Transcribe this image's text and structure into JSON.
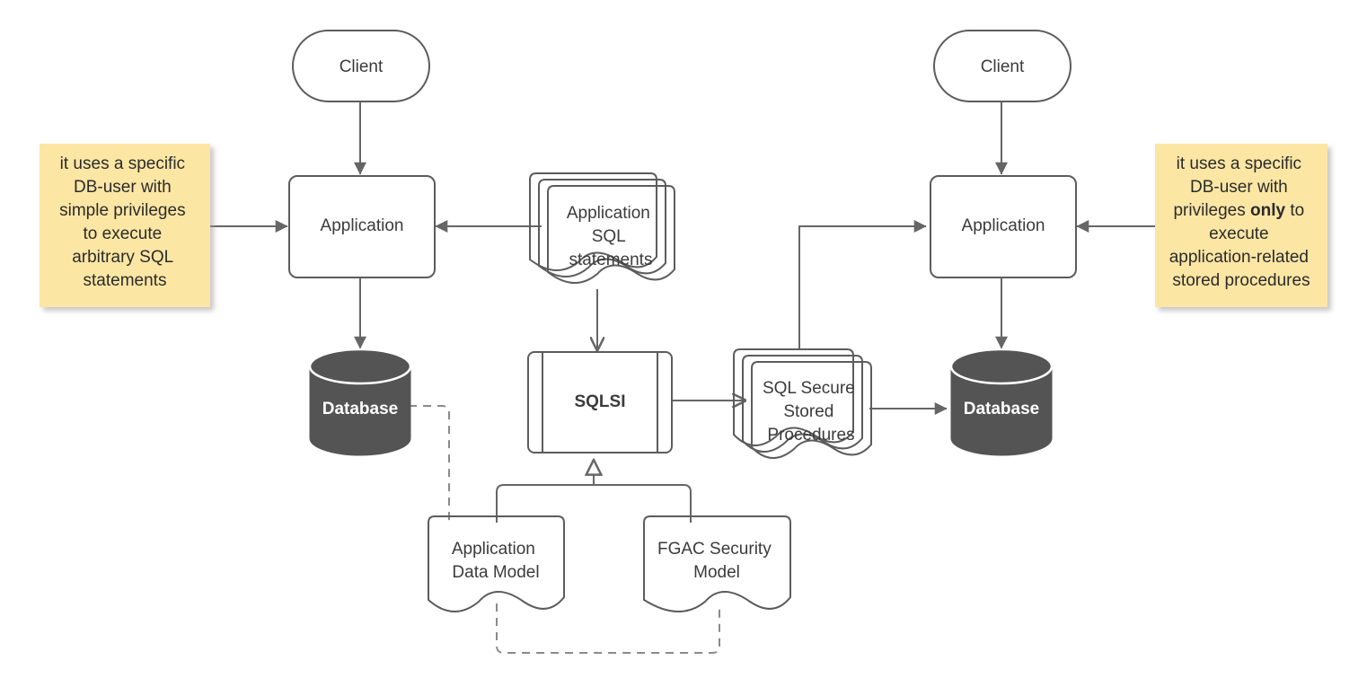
{
  "diagram": {
    "title": "SQLSI secure database access architecture",
    "colors": {
      "background": "#ffffff",
      "stroke": "#5c5c5c",
      "edge": "#666666",
      "edge_dashed": "#8a8a8a",
      "note_fill": "#fce6a4",
      "document_gray_fill": "#d3d3d3",
      "document_yellow_fill": "#fce6a4",
      "sqlsi_fill": "#9fd5f3",
      "database_fill": "#545454",
      "text": "#3b3b3b",
      "database_text": "#ffffff"
    },
    "nodes": {
      "client_left": {
        "label": "Client",
        "shape": "stadium"
      },
      "client_right": {
        "label": "Client",
        "shape": "stadium"
      },
      "application_left": {
        "label": "Application",
        "shape": "rounded-rect"
      },
      "application_right": {
        "label": "Application",
        "shape": "rounded-rect"
      },
      "database_left": {
        "label": "Database",
        "shape": "cylinder"
      },
      "database_right": {
        "label": "Database",
        "shape": "cylinder"
      },
      "application_sql_statements": {
        "lines": [
          "Application",
          "SQL",
          "statements"
        ],
        "shape": "stacked-document"
      },
      "sql_secure_stored_procedures": {
        "lines": [
          "SQL Secure",
          "Stored",
          "Procedures"
        ],
        "shape": "stacked-document"
      },
      "sqlsi": {
        "label": "SQLSI",
        "shape": "component"
      },
      "application_data_model": {
        "lines": [
          "Application",
          "Data Model"
        ],
        "shape": "document"
      },
      "fgac_security_model": {
        "lines": [
          "FGAC Security",
          "Model"
        ],
        "shape": "document"
      }
    },
    "notes": {
      "left": {
        "lines": [
          [
            {
              "text": "it uses a specific",
              "bold": false
            }
          ],
          [
            {
              "text": "DB-user with",
              "bold": false
            }
          ],
          [
            {
              "text": "simple privileges",
              "bold": false
            }
          ],
          [
            {
              "text": "to execute",
              "bold": false
            }
          ],
          [
            {
              "text": "arbitrary SQL",
              "bold": false
            }
          ],
          [
            {
              "text": "statements",
              "bold": false
            }
          ]
        ]
      },
      "right": {
        "lines": [
          [
            {
              "text": "it uses a specific",
              "bold": false
            }
          ],
          [
            {
              "text": "DB-user with",
              "bold": false
            }
          ],
          [
            {
              "text": "privileges ",
              "bold": false
            },
            {
              "text": "only",
              "bold": true
            },
            {
              "text": " to",
              "bold": false
            }
          ],
          [
            {
              "text": "execute",
              "bold": false
            }
          ],
          [
            {
              "text": "application-related",
              "bold": false
            }
          ],
          [
            {
              "text": "stored procedures",
              "bold": false
            }
          ]
        ]
      }
    },
    "edges": [
      {
        "from": "client_left",
        "to": "application_left",
        "style": "solid",
        "arrow": "filled"
      },
      {
        "from": "application_sql_statements",
        "to": "application_left",
        "style": "solid",
        "arrow": "filled"
      },
      {
        "from": "note_left",
        "to": "application_left",
        "style": "solid",
        "arrow": "filled"
      },
      {
        "from": "application_left",
        "to": "database_left",
        "style": "solid",
        "arrow": "filled"
      },
      {
        "from": "application_sql_statements",
        "to": "sqlsi",
        "style": "solid",
        "arrow": "open"
      },
      {
        "from": "sqlsi",
        "to": "sql_secure_stored_procedures",
        "style": "solid",
        "arrow": "open"
      },
      {
        "from": "sql_secure_stored_procedures",
        "to": "application_right",
        "style": "solid",
        "arrow": "filled"
      },
      {
        "from": "sql_secure_stored_procedures",
        "to": "database_right",
        "style": "solid",
        "arrow": "filled"
      },
      {
        "from": "client_right",
        "to": "application_right",
        "style": "solid",
        "arrow": "filled"
      },
      {
        "from": "note_right",
        "to": "application_right",
        "style": "solid",
        "arrow": "filled"
      },
      {
        "from": "application_right",
        "to": "database_right",
        "style": "solid",
        "arrow": "filled"
      },
      {
        "from": "application_data_model",
        "to": "sqlsi",
        "style": "solid",
        "arrow": "hollow-triangle"
      },
      {
        "from": "fgac_security_model",
        "to": "sqlsi",
        "style": "solid",
        "arrow": "hollow-triangle"
      },
      {
        "from": "database_left",
        "to": "application_data_model",
        "style": "dashed",
        "arrow": "none"
      },
      {
        "from": "application_data_model",
        "to": "fgac_security_model",
        "style": "dashed",
        "arrow": "none"
      }
    ]
  }
}
